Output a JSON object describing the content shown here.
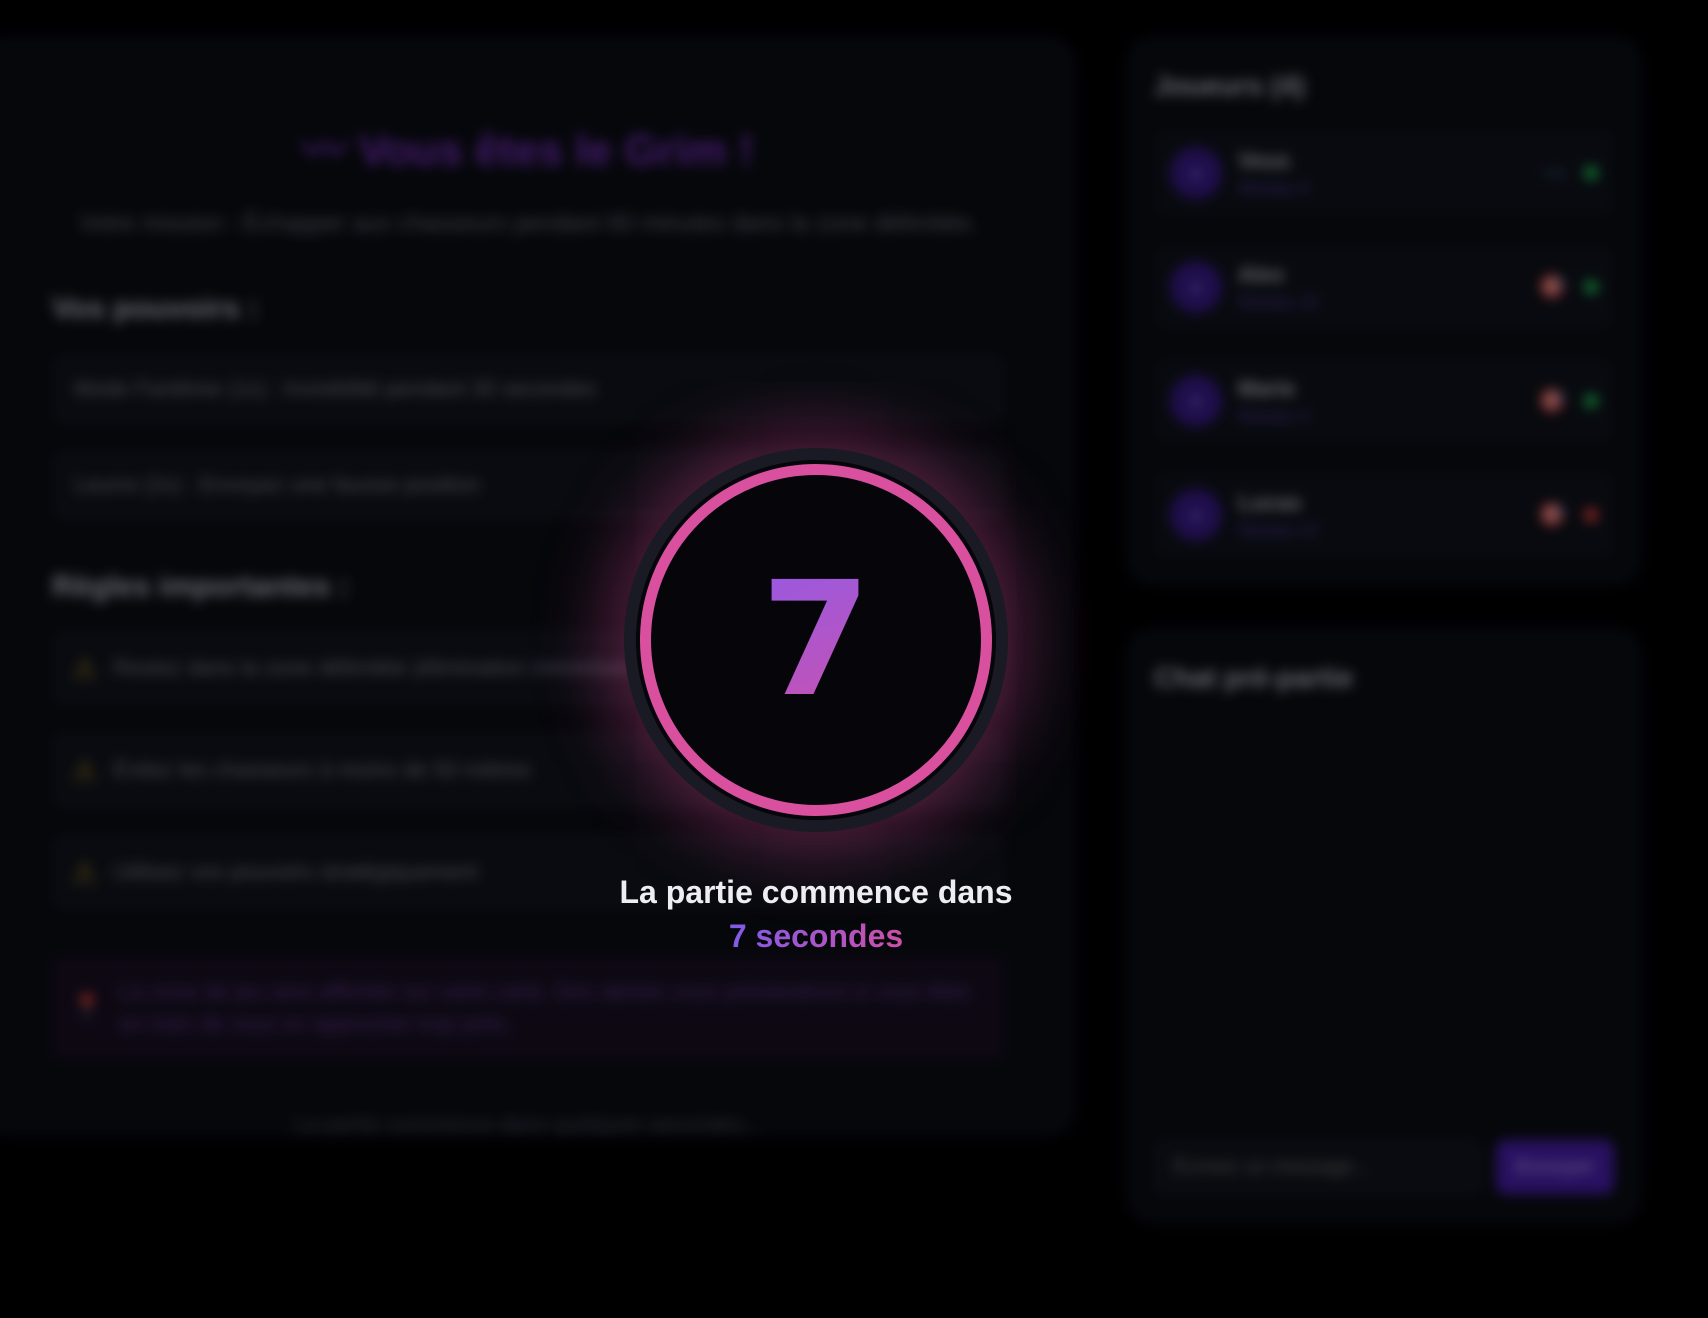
{
  "role": {
    "glyph": "〰",
    "title": "Vous êtes le Grim !",
    "mission": "Votre mission : Échapper aux chasseurs pendant 60 minutes dans la zone délimitée."
  },
  "powers": {
    "title": "Vos pouvoirs :",
    "items": [
      "Mode Fantôme (1x) : Invisibilité pendant 30 secondes",
      "Leurre (2x) : Envoyez une fausse position"
    ]
  },
  "rules": {
    "title": "Règles importantes :",
    "items": [
      "Restez dans la zone délimitée (élimination immédiate en cas de sortie)",
      "Évitez les chasseurs à moins de 50 mètres",
      "Utilisez vos pouvoirs stratégiquement"
    ],
    "warn_icon": "⚠"
  },
  "note": {
    "icon": "📍",
    "text": "La zone de jeu sera affichée sur votre carte. Des alertes vous préviendront si vous êtes en train de vous en approcher trop près."
  },
  "footer": "La partie commence dans quelques secondes...",
  "players": {
    "title": "Joueurs (4)",
    "list": [
      {
        "name": "Vous",
        "level": "Niveau 4",
        "role_icon": "〰",
        "status_color": "#22c55e"
      },
      {
        "name": "Alex",
        "level": "Niveau 12",
        "role_icon": "🎯",
        "status_color": "#22c55e"
      },
      {
        "name": "Marie",
        "level": "Niveau 3",
        "role_icon": "🎯",
        "status_color": "#22c55e"
      },
      {
        "name": "Lucas",
        "level": "Niveau 12",
        "role_icon": "🎯",
        "status_color": "#ef4444"
      }
    ]
  },
  "chat": {
    "title": "Chat pré-partie",
    "placeholder": "Écrivez un message...",
    "send_label": "Envoyer"
  },
  "countdown": {
    "number": "7",
    "label": "La partie commence dans",
    "seconds_text": "7 secondes"
  }
}
